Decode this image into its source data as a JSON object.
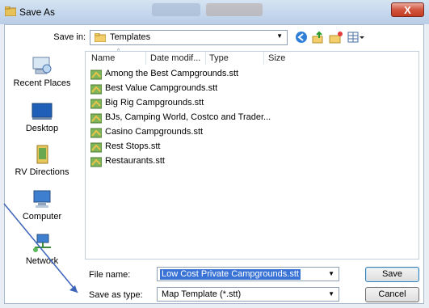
{
  "window": {
    "title": "Save As",
    "close_glyph": "X"
  },
  "header": {
    "save_in_label": "Save in:",
    "save_in_value": "Templates",
    "toolbar_icons": [
      "back-icon",
      "up-folder-icon",
      "new-folder-icon",
      "view-menu-icon"
    ]
  },
  "places": [
    {
      "label": "Recent Places",
      "icon": "recent-places-icon"
    },
    {
      "label": "Desktop",
      "icon": "desktop-icon"
    },
    {
      "label": "RV Directions",
      "icon": "rv-directions-folder-icon"
    },
    {
      "label": "Computer",
      "icon": "computer-icon"
    },
    {
      "label": "Network",
      "icon": "network-icon"
    }
  ],
  "columns": [
    "Name",
    "Date modif...",
    "Type",
    "Size"
  ],
  "files": [
    "Among the Best Campgrounds.stt",
    "Best Value Campgrounds.stt",
    "Big Rig Campgrounds.stt",
    "BJs, Camping World, Costco and Trader...",
    "Casino Campgrounds.stt",
    "Rest Stops.stt",
    "Restaurants.stt"
  ],
  "footer": {
    "file_name_label": "File name:",
    "file_name_value": "Low Cost Private Campgrounds.stt",
    "save_as_type_label": "Save as type:",
    "save_as_type_value": "Map Template (*.stt)",
    "save_button": "Save",
    "cancel_button": "Cancel"
  },
  "colors": {
    "accent": "#3a73d6",
    "arrow": "#3b63b8",
    "close": "#c43c22"
  }
}
